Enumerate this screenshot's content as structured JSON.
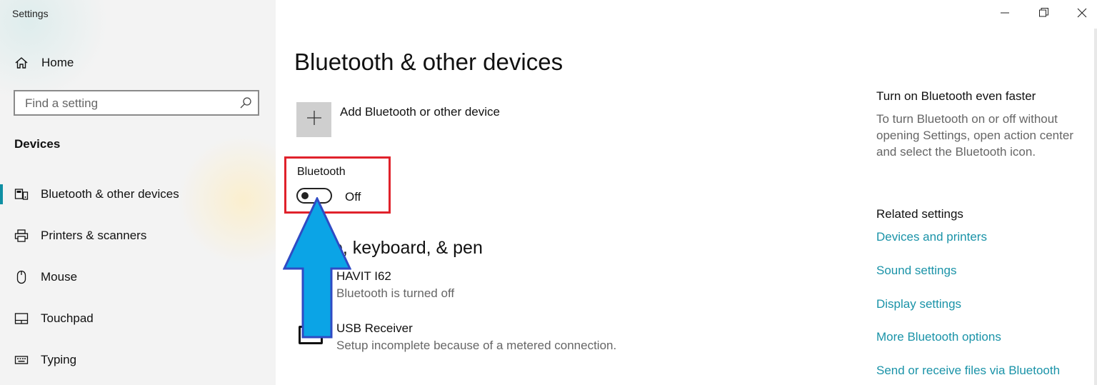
{
  "window": {
    "title": "Settings",
    "controls": {
      "minimize_icon": "minimize-icon",
      "restore_icon": "restore-icon",
      "close_icon": "close-icon"
    }
  },
  "sidebar": {
    "home_label": "Home",
    "search": {
      "placeholder": "Find a setting",
      "value": ""
    },
    "section_title": "Devices",
    "items": [
      {
        "label": "Bluetooth & other devices",
        "icon": "bluetooth-devices-icon",
        "active": true
      },
      {
        "label": "Printers & scanners",
        "icon": "printer-icon",
        "active": false
      },
      {
        "label": "Mouse",
        "icon": "mouse-icon",
        "active": false
      },
      {
        "label": "Touchpad",
        "icon": "touchpad-icon",
        "active": false
      },
      {
        "label": "Typing",
        "icon": "keyboard-icon",
        "active": false
      }
    ]
  },
  "main": {
    "title": "Bluetooth & other devices",
    "add_device_label": "Add Bluetooth or other device",
    "bluetooth": {
      "label": "Bluetooth",
      "state": "Off",
      "on": false
    },
    "section_heading": "e, keyboard, & pen",
    "devices": [
      {
        "name": "HAVIT I62",
        "status": "Bluetooth is turned off"
      },
      {
        "name": "USB Receiver",
        "status": "Setup incomplete because of a metered connection."
      }
    ]
  },
  "right": {
    "tip_title": "Turn on Bluetooth even faster",
    "tip_text": "To turn Bluetooth on or off without opening Settings, open action center and select the Bluetooth icon.",
    "related_title": "Related settings",
    "links": [
      "Devices and printers",
      "Sound settings",
      "Display settings",
      "More Bluetooth options",
      "Send or receive files via Bluetooth"
    ]
  },
  "colors": {
    "accent": "#1a93a8",
    "highlight_box": "#e0222b",
    "arrow_fill": "#0ba4e6",
    "arrow_stroke": "#2f4bc4"
  }
}
